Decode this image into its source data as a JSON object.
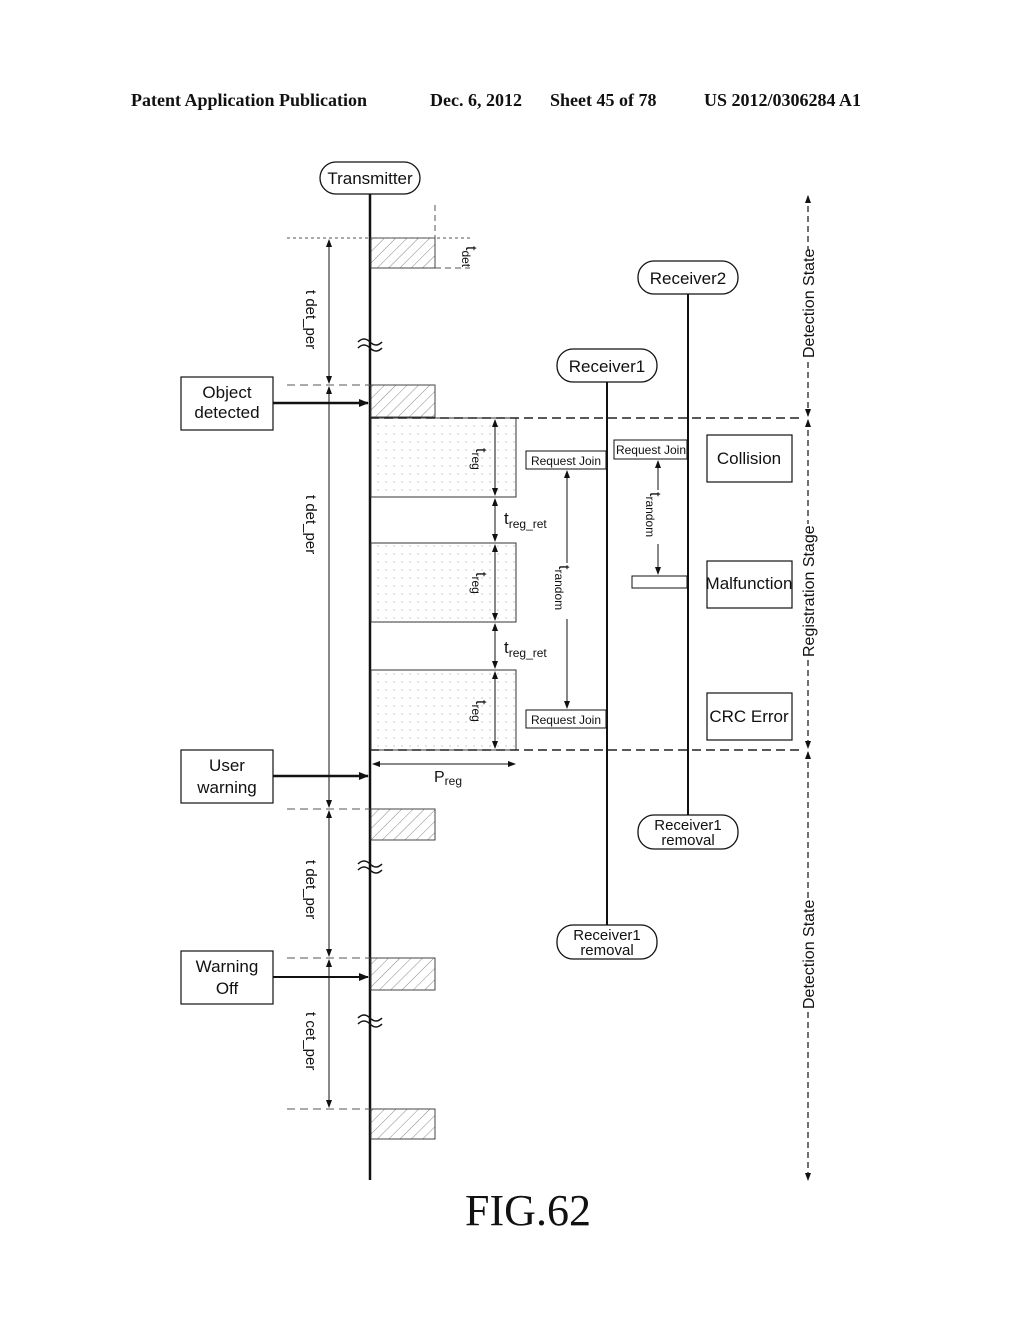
{
  "header": {
    "publication": "Patent Application Publication",
    "date": "Dec. 6, 2012",
    "sheet": "Sheet 45 of 78",
    "number": "US 2012/0306284 A1"
  },
  "figure_label": "FIG.62",
  "lifelines": {
    "transmitter": "Transmitter",
    "receiver1": "Receiver1",
    "receiver2": "Receiver2",
    "receiver1_removal_a": [
      "Receiver1",
      "removal"
    ],
    "receiver1_removal_b": [
      "Receiver1",
      "removal"
    ]
  },
  "events": {
    "object_detected": [
      "Object",
      "detected"
    ],
    "user_warning": [
      "User",
      "warning"
    ],
    "warning_off": [
      "Warning",
      "Off"
    ]
  },
  "timing": {
    "t_det": "t",
    "t_det_sub": "det",
    "t_det_per": "t det_per",
    "t_cet_per": "t cet_per",
    "t_reg": "t",
    "t_reg_sub": "reg",
    "t_reg_ret": "t",
    "t_reg_ret_sub": "reg_ret",
    "t_random": "t",
    "t_random_sub": "random",
    "p_reg": "P",
    "p_reg_sub": "reg"
  },
  "messages": {
    "request_join": "Request Join"
  },
  "errors": {
    "collision": "Collision",
    "malfunction": "Malfunction",
    "crc_error": "CRC Error"
  },
  "stages": {
    "detection_top": "Detection State",
    "registration": "Registration Stage",
    "detection_bottom": "Detection State"
  }
}
